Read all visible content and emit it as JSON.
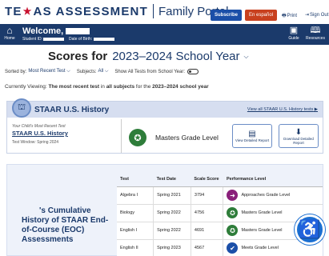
{
  "header": {
    "brand_pre": "TE",
    "brand_post": "AS ASSESSMENT",
    "portal": "Family Portal",
    "subscribe": "Subscribe",
    "espanol": "En español",
    "print": "Print",
    "sign_out": "Sign Out"
  },
  "welcome": {
    "home": "Home",
    "greeting": "Welcome,",
    "student_id_label": "Student ID:",
    "dob_label": "Date of Birth:",
    "guide": "Guide",
    "resources": "Resources"
  },
  "scores": {
    "label": "Scores for",
    "year": "2023–2024 School Year"
  },
  "sort": {
    "sorted_by_label": "Sorted by:",
    "sorted_by_value": "Most Recent Test",
    "subjects_label": "Subjects:",
    "subjects_value": "All",
    "show_all_label": "Show All Tests from School Year:"
  },
  "viewing": {
    "prefix": "Currently Viewing: ",
    "bold1": "The most recent test",
    "mid": " in ",
    "bold2": "all subjects",
    "suffix": " for the ",
    "bold3": "2023–2024 school year"
  },
  "card": {
    "title": "STAAR U.S. History",
    "view_all": "View all STAAR U.S. History tests",
    "recent_label": "Your Child's Most Recent Test",
    "recent_name": "STAAR U.S. History",
    "window_label": "Test Window:",
    "window_value": "Spring 2024",
    "level": "Masters Grade Level",
    "view_report": "View Detailed Report",
    "download_report": "Download Detailed Report"
  },
  "history": {
    "title_tail": "'s Cumulative History of STAAR End-of-Course (EOC) Assessments",
    "columns": [
      "Test",
      "Test Date",
      "Scale Score",
      "Performance Level"
    ],
    "rows": [
      {
        "test": "Algebra I",
        "date": "Spring 2021",
        "score": "3794",
        "level": "Approaches Grade Level"
      },
      {
        "test": "Biology",
        "date": "Spring 2022",
        "score": "4756",
        "level": "Masters Grade Level"
      },
      {
        "test": "English I",
        "date": "Spring 2022",
        "score": "4691",
        "level": "Masters Grade Level"
      },
      {
        "test": "English II",
        "date": "Spring 2023",
        "score": "4567",
        "level": "Meets Grade Level"
      }
    ]
  },
  "colors": {
    "navy": "#1b3a6b",
    "approaches": "#8a1f7a",
    "masters": "#2e7d3a",
    "meets": "#1b4fa8",
    "accessibility": "#1b6fd1"
  }
}
